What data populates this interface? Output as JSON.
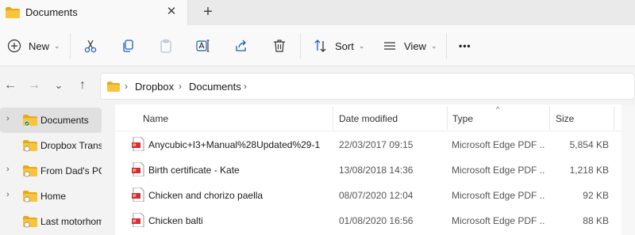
{
  "tab": {
    "title": "Documents",
    "close": "✕",
    "new": "+"
  },
  "toolbar": {
    "new_label": "New",
    "sort_label": "Sort",
    "view_label": "View",
    "more": "•••",
    "chev": "⌄"
  },
  "nav": {
    "back": "←",
    "forward": "→",
    "recent": "⌄",
    "up": "↑"
  },
  "breadcrumb": {
    "items": [
      "Dropbox",
      "Documents"
    ],
    "sep": "›"
  },
  "sidebar": {
    "items": [
      {
        "label": "Documents",
        "expander": "›"
      },
      {
        "label": "Dropbox Transfer",
        "expander": ""
      },
      {
        "label": "From Dad's PC",
        "expander": "›"
      },
      {
        "label": "Home",
        "expander": "›"
      },
      {
        "label": "Last motorhome",
        "expander": ""
      }
    ]
  },
  "columns": {
    "name": "Name",
    "date": "Date modified",
    "type": "Type",
    "size": "Size",
    "sort_indicator": "^"
  },
  "files": [
    {
      "name": "Anycubic+I3+Manual%28Updated%29-1",
      "date": "22/03/2017 09:15",
      "type": "Microsoft Edge PDF ...",
      "size": "5,854 KB"
    },
    {
      "name": "Birth certificate - Kate",
      "date": "13/08/2018 14:36",
      "type": "Microsoft Edge PDF ...",
      "size": "1,218 KB"
    },
    {
      "name": "Chicken and chorizo paella",
      "date": "08/07/2020 12:04",
      "type": "Microsoft Edge PDF ...",
      "size": "92 KB"
    },
    {
      "name": "Chicken balti",
      "date": "01/08/2020 16:56",
      "type": "Microsoft Edge PDF ...",
      "size": "88 KB"
    }
  ],
  "colors": {
    "folder": "#f8c43b",
    "folder_dark": "#e6a817",
    "accent": "#0067c0",
    "pdf_red": "#d32f2f"
  }
}
